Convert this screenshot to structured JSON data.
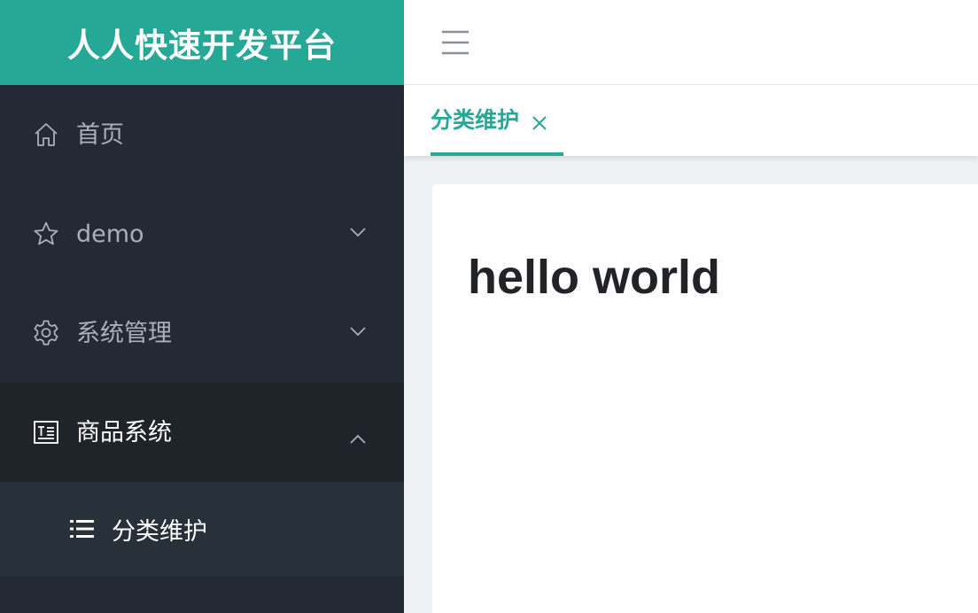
{
  "brand": {
    "title": "人人快速开发平台"
  },
  "sidebar": {
    "items": [
      {
        "label": "首页",
        "icon": "home-icon"
      },
      {
        "label": "demo",
        "icon": "star-icon",
        "arrow": "chevron-down-icon"
      },
      {
        "label": "系统管理",
        "icon": "gear-icon",
        "arrow": "chevron-down-icon"
      },
      {
        "label": "商品系统",
        "icon": "document-icon",
        "arrow": "chevron-up-icon",
        "open": true
      }
    ],
    "sub_items": [
      {
        "label": "分类维护",
        "icon": "list-icon",
        "active": true
      }
    ]
  },
  "topbar": {
    "menu_toggle_icon": "hamburger-icon"
  },
  "tabs": [
    {
      "label": "分类维护",
      "close_icon": "close-icon",
      "active": true
    }
  ],
  "content": {
    "heading": "hello world"
  },
  "colors": {
    "accent": "#26a896",
    "sidebar_bg": "#242a33",
    "sidebar_open_bg": "#1f242b",
    "submenu_bg": "#283039"
  }
}
